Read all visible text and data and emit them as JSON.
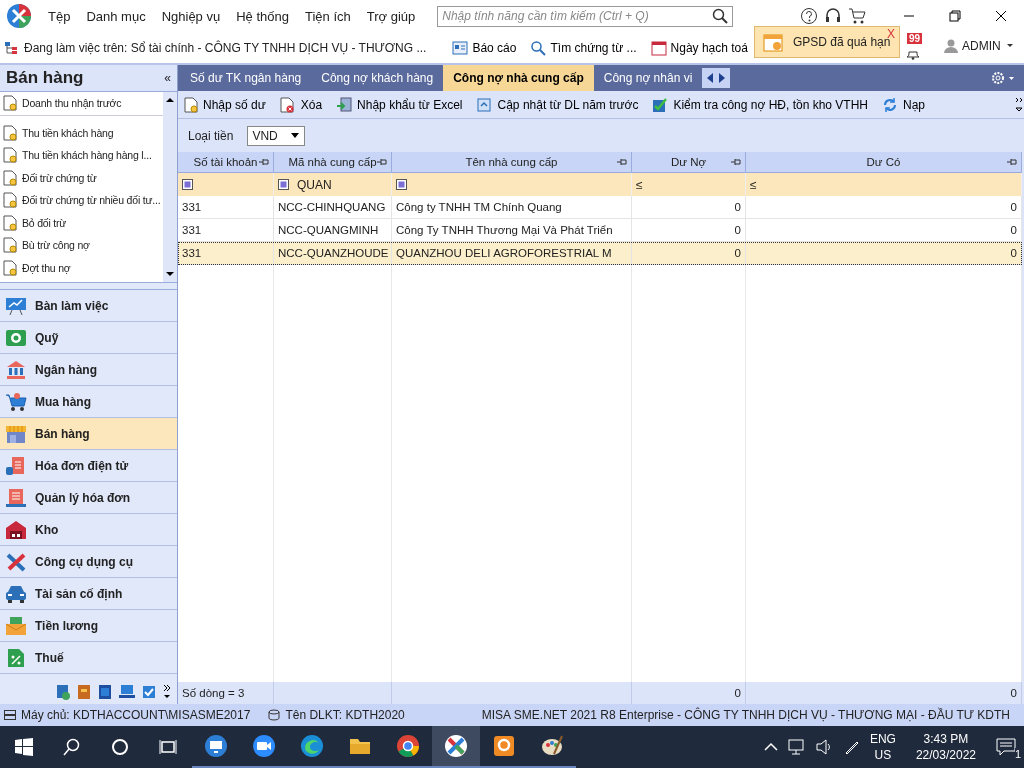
{
  "menu": [
    "Tệp",
    "Danh mục",
    "Nghiệp vụ",
    "Hệ thống",
    "Tiện ích",
    "Trợ giúp"
  ],
  "search": {
    "placeholder": "Nhập tính năng cần tìm kiếm (Ctrl + Q)"
  },
  "toolbar": {
    "working_on": "Đang làm việc trên: Sổ tài chính - CÔNG TY TNHH DỊCH VỤ - THƯƠNG ...",
    "buttons": [
      {
        "kind": "report",
        "label": "Báo cáo"
      },
      {
        "kind": "search",
        "label": "Tìm chứng từ ..."
      },
      {
        "kind": "calendar",
        "label": "Ngày hạch toá"
      }
    ]
  },
  "notification": {
    "text": "GPSD đã quá hạn",
    "close": "X"
  },
  "bell_badge": "99",
  "user": "ADMIN",
  "sidebar": {
    "title": "Bán hàng",
    "collapse": "«",
    "items": [
      "Doanh thu nhận trước",
      "Thu tiền khách hàng",
      "Thu tiền khách hàng hàng l...",
      "Đối trừ chứng từ",
      "Đối trừ chứng từ nhiều đối tư...",
      "Bỏ đối trừ",
      "Bù trừ công nợ",
      "Đợt thu nợ"
    ],
    "modules": [
      {
        "kind": "desk",
        "label": "Bàn làm việc",
        "selected": false
      },
      {
        "kind": "cash",
        "label": "Quỹ",
        "selected": false
      },
      {
        "kind": "bank",
        "label": "Ngân hàng",
        "selected": false
      },
      {
        "kind": "cart",
        "label": "Mua hàng",
        "selected": false
      },
      {
        "kind": "shop",
        "label": "Bán hàng",
        "selected": true
      },
      {
        "kind": "einvoice",
        "label": "Hóa đơn điện tử",
        "selected": false
      },
      {
        "kind": "invoice",
        "label": "Quản lý hóa đơn",
        "selected": false
      },
      {
        "kind": "warehouse",
        "label": "Kho",
        "selected": false
      },
      {
        "kind": "tools",
        "label": "Công cụ dụng cụ",
        "selected": false
      },
      {
        "kind": "car",
        "label": "Tài sản cố định",
        "selected": false
      },
      {
        "kind": "salary",
        "label": "Tiền lương",
        "selected": false
      },
      {
        "kind": "tax",
        "label": "Thuế",
        "selected": false
      }
    ]
  },
  "tabs": [
    {
      "label": "Số dư TK ngân hàng",
      "selected": false
    },
    {
      "label": "Công nợ khách hàng",
      "selected": false
    },
    {
      "label": "Công nợ nhà cung cấp",
      "selected": true
    },
    {
      "label": "Công nợ nhân vi",
      "selected": false
    }
  ],
  "actions": [
    {
      "kind": "new",
      "label": "Nhập số dư"
    },
    {
      "kind": "delete",
      "label": "Xóa"
    },
    {
      "kind": "import",
      "label": "Nhập khẩu từ Excel"
    },
    {
      "kind": "update",
      "label": "Cập nhật từ DL năm trước"
    },
    {
      "kind": "check",
      "label": "Kiểm tra công nợ HĐ, tồn kho VTHH"
    },
    {
      "kind": "reload",
      "label": "Nạp"
    }
  ],
  "currency": {
    "label": "Loại tiền",
    "value": "VND"
  },
  "table": {
    "columns": [
      "Số tài khoản",
      "Mã nhà cung cấp",
      "Tên nhà cung cấp",
      "Dư Nợ",
      "Dư Có"
    ],
    "filters": [
      {
        "kind": "match"
      },
      {
        "kind": "match",
        "value": "QUAN"
      },
      {
        "kind": "match"
      },
      {
        "kind": "compare",
        "value": "≤"
      },
      {
        "kind": "compare",
        "value": "≤"
      }
    ],
    "rows": [
      {
        "cells": [
          "331",
          "NCC-CHINHQUANG",
          "Công ty TNHH TM Chính Quang",
          "0",
          "0"
        ],
        "selected": false
      },
      {
        "cells": [
          "331",
          "NCC-QUANGMINH",
          "Công Ty TNHH Thương Mại Và Phát Triển",
          "0",
          "0"
        ],
        "selected": false
      },
      {
        "cells": [
          "331",
          "NCC-QUANZHOUDE",
          "QUANZHOU DELI AGROFORESTRIAL M",
          "0",
          "0"
        ],
        "selected": true
      }
    ],
    "footer": {
      "count": "Số dòng = 3",
      "totals": [
        "0",
        "0"
      ]
    }
  },
  "status_bar": {
    "server": "Máy chủ: KDTHACCOUNT\\MISASME2017",
    "database": "Tên DLKT: KDTH2020",
    "product": "MISA SME.NET 2021 R8 Enterprise - CÔNG TY TNHH DỊCH VỤ - THƯƠNG MẠI - ĐẦU TƯ KDTH"
  },
  "taskbar": {
    "apps": [
      {
        "kind": "remote",
        "selected": false
      },
      {
        "kind": "video",
        "selected": false
      },
      {
        "kind": "edge",
        "selected": false
      },
      {
        "kind": "folder",
        "selected": false
      },
      {
        "kind": "chrome",
        "selected": false
      },
      {
        "kind": "misa",
        "selected": true
      },
      {
        "kind": "pdf",
        "selected": false
      },
      {
        "kind": "paint",
        "selected": false
      }
    ],
    "language": "ENG",
    "region": "US",
    "time": "3:43 PM",
    "date": "22/03/2022",
    "notifications": "1"
  }
}
